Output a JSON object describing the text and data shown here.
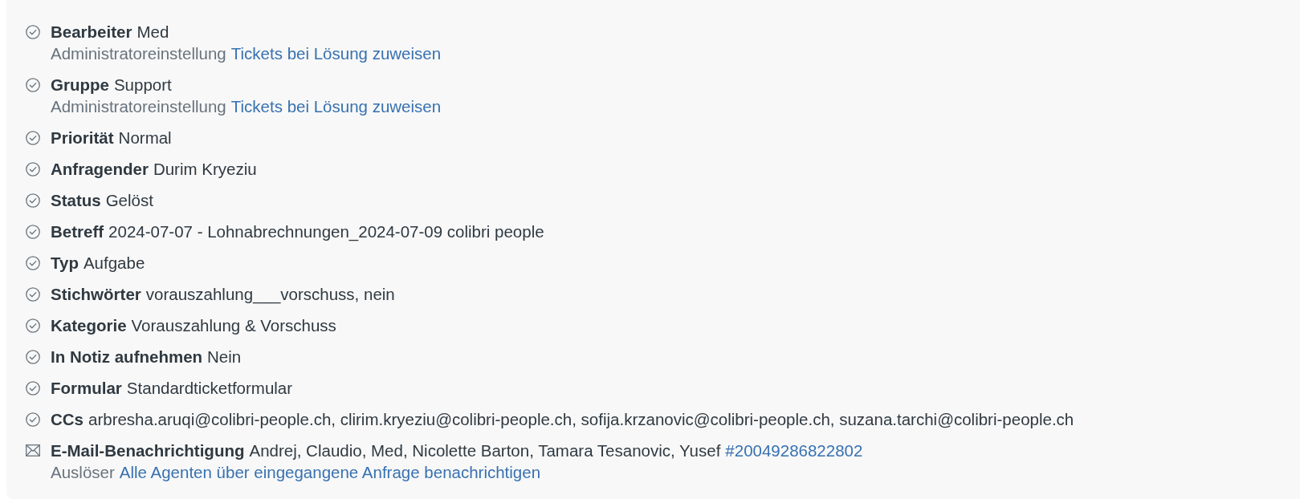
{
  "events": [
    {
      "kind": "change",
      "label": "Bearbeiter",
      "value": "Med",
      "detail": {
        "label": "Administratoreinstellung",
        "link": "Tickets bei Lösung zuweisen"
      }
    },
    {
      "kind": "change",
      "label": "Gruppe",
      "value": "Support",
      "detail": {
        "label": "Administratoreinstellung",
        "link": "Tickets bei Lösung zuweisen"
      }
    },
    {
      "kind": "change",
      "label": "Priorität",
      "value": "Normal"
    },
    {
      "kind": "change",
      "label": "Anfragender",
      "value": "Durim Kryeziu"
    },
    {
      "kind": "change",
      "label": "Status",
      "value": "Gelöst"
    },
    {
      "kind": "change",
      "label": "Betreff",
      "value": "2024-07-07 - Lohnabrechnungen_2024-07-09 colibri people"
    },
    {
      "kind": "change",
      "label": "Typ",
      "value": "Aufgabe"
    },
    {
      "kind": "change",
      "label": "Stichwörter",
      "value": "vorauszahlung___vorschuss, nein"
    },
    {
      "kind": "change",
      "label": "Kategorie",
      "value": "Vorauszahlung & Vorschuss"
    },
    {
      "kind": "change",
      "label": "In Notiz aufnehmen",
      "value": "Nein"
    },
    {
      "kind": "change",
      "label": "Formular",
      "value": "Standardticketformular"
    },
    {
      "kind": "change",
      "label": "CCs",
      "value": "arbresha.aruqi@colibri-people.ch, clirim.kryeziu@colibri-people.ch, sofija.krzanovic@colibri-people.ch, suzana.tarchi@colibri-people.ch"
    },
    {
      "kind": "email",
      "label": "E-Mail-Benachrichtigung",
      "value": "Andrej, Claudio, Med, Nicolette Barton, Tamara Tesanovic, Yusef",
      "link": "#20049286822802",
      "detail": {
        "label": "Auslöser",
        "link": "Alle Agenten über eingegangene Anfrage benachrichtigen"
      }
    }
  ]
}
